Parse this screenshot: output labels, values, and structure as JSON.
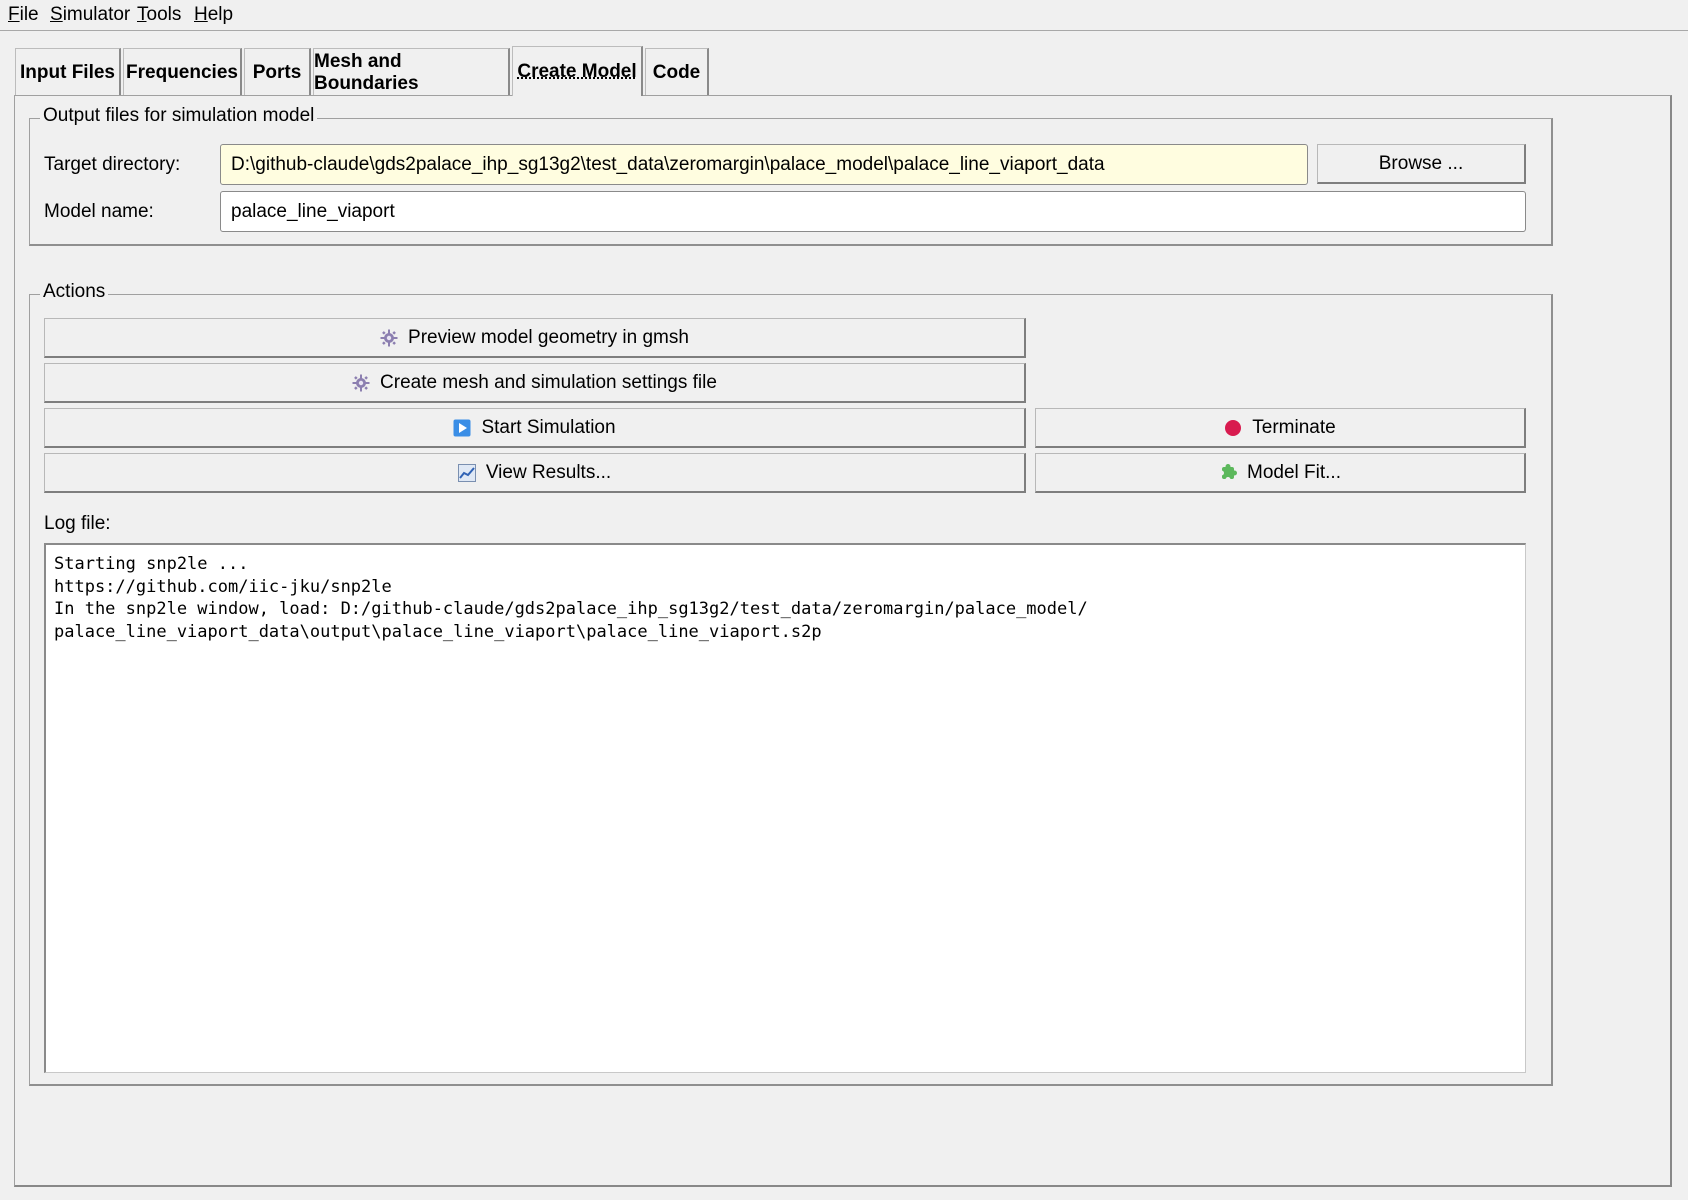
{
  "menu": {
    "file": {
      "acc": "F",
      "rest": "ile"
    },
    "simulator": {
      "acc": "S",
      "rest": "imulator"
    },
    "tools": {
      "acc": "T",
      "rest": "ools"
    },
    "help": {
      "acc": "H",
      "rest": "elp"
    }
  },
  "tabs": [
    "Input Files",
    "Frequencies",
    "Ports",
    "Mesh and Boundaries",
    "Create Model",
    "Code"
  ],
  "active_tab": "Create Model",
  "output_group": {
    "title": "Output files for simulation model",
    "target_label": "Target directory:",
    "target_value": "D:\\github-claude\\gds2palace_ihp_sg13g2\\test_data\\zeromargin\\palace_model\\palace_line_viaport_data",
    "browse_label": "Browse ...",
    "model_label": "Model name:",
    "model_value": "palace_line_viaport"
  },
  "actions_group": {
    "title": "Actions",
    "preview_label": "Preview model geometry in gmsh",
    "create_mesh_label": "Create mesh and simulation settings file",
    "start_label": "Start Simulation",
    "terminate_label": "Terminate",
    "view_results_label": "View Results...",
    "model_fit_label": "Model Fit...",
    "log_label": "Log file:",
    "log_lines": [
      "Starting snp2le ...",
      "https://github.com/iic-jku/snp2le",
      "In the snp2le window, load: D:/github-claude/gds2palace_ihp_sg13g2/test_data/zeromargin/palace_model/",
      "palace_line_viaport_data\\output\\palace_line_viaport\\palace_line_viaport.s2p"
    ]
  },
  "colors": {
    "background": "#f0f0f0",
    "highlight_field": "#fffde0",
    "terminate_red": "#d81b4f",
    "start_blue": "#3a8ee6",
    "model_fit_green": "#5cb85c"
  },
  "icons": {
    "preview": "gear-icon",
    "create_mesh": "gear-icon",
    "start": "play-icon",
    "terminate": "stop-icon",
    "view_results": "chart-icon",
    "model_fit": "puzzle-icon"
  }
}
